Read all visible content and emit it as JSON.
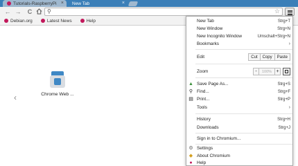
{
  "tabs": [
    {
      "label": "Tutorials-RaspberryPi",
      "close": "×"
    },
    {
      "label": "New Tab",
      "close": "×"
    }
  ],
  "toolbar": {
    "back": "←",
    "forward": "→",
    "reload": "C",
    "search_glyph": "⚲",
    "star": "☆"
  },
  "bookmarks": [
    {
      "label": "Debian.org"
    },
    {
      "label": "Latest News"
    },
    {
      "label": "Help"
    }
  ],
  "page": {
    "left_arrow": "‹",
    "app_label": "Chrome Web ..."
  },
  "menu": {
    "new_tab": {
      "label": "New Tab",
      "shortcut": "Strg+T"
    },
    "new_window": {
      "label": "New Window",
      "shortcut": "Strg+N"
    },
    "new_incognito": {
      "label": "New Incognito Window",
      "shortcut": "Umschalt+Strg+N"
    },
    "bookmarks": {
      "label": "Bookmarks",
      "arrow": "›"
    },
    "edit": {
      "label": "Edit",
      "cut": "Cut",
      "copy": "Copy",
      "paste": "Paste"
    },
    "zoom": {
      "label": "Zoom",
      "minus": "-",
      "value": "100%",
      "plus": "+"
    },
    "save_page": {
      "label": "Save Page As...",
      "shortcut": "Strg+S"
    },
    "find": {
      "label": "Find...",
      "shortcut": "Strg+F"
    },
    "print": {
      "label": "Print...",
      "shortcut": "Strg+P"
    },
    "tools": {
      "label": "Tools",
      "arrow": "›"
    },
    "history": {
      "label": "History",
      "shortcut": "Strg+H"
    },
    "downloads": {
      "label": "Downloads",
      "shortcut": "Strg+J"
    },
    "signin": {
      "label": "Sign in to Chromium..."
    },
    "settings": {
      "label": "Settings"
    },
    "about": {
      "label": "About Chromium"
    },
    "help": {
      "label": "Help"
    }
  }
}
